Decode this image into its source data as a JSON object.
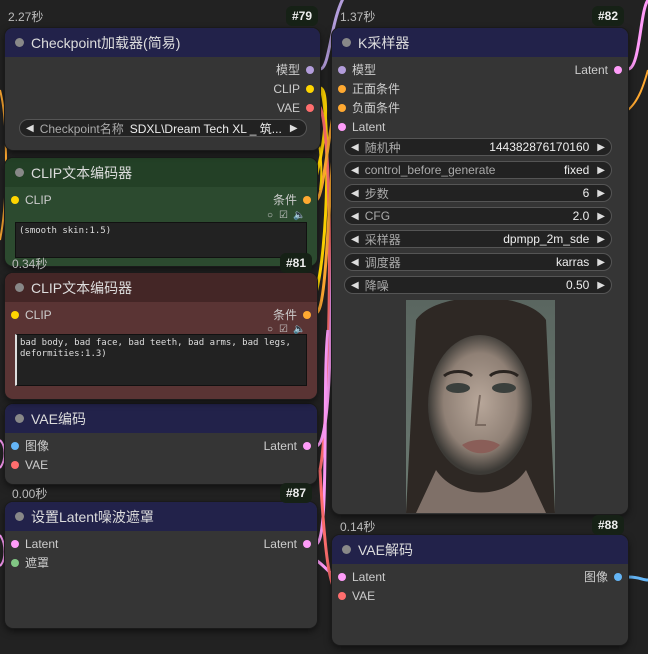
{
  "nodes": {
    "checkpoint": {
      "time": "2.27秒",
      "id": "#79",
      "title": "Checkpoint加载器(简易)",
      "outputs": [
        "模型",
        "CLIP",
        "VAE"
      ],
      "widget": {
        "label": "Checkpoint名称",
        "value": "SDXL\\Dream Tech XL _ 筑..."
      }
    },
    "ksampler": {
      "time": "1.37秒",
      "id": "#82",
      "title": "K采样器",
      "inputs": [
        "模型",
        "正面条件",
        "负面条件",
        "Latent"
      ],
      "output": "Latent",
      "widgets": [
        {
          "label": "随机种",
          "value": "144382876170160"
        },
        {
          "label": "control_before_generate",
          "value": "fixed"
        },
        {
          "label": "步数",
          "value": "6"
        },
        {
          "label": "CFG",
          "value": "2.0"
        },
        {
          "label": "采样器",
          "value": "dpmpp_2m_sde"
        },
        {
          "label": "调度器",
          "value": "karras"
        },
        {
          "label": "降噪",
          "value": "0.50"
        }
      ]
    },
    "clip_pos": {
      "title": "CLIP文本编码器",
      "input": "CLIP",
      "output": "条件",
      "text": "(smooth skin:1.5)"
    },
    "clip_neg": {
      "time": "0.34秒",
      "id": "#81",
      "title": "CLIP文本编码器",
      "input": "CLIP",
      "output": "条件",
      "text": "bad body, bad face, bad teeth, bad arms, bad legs,\ndeformities:1.3)"
    },
    "vae_encode": {
      "title": "VAE编码",
      "inputs": [
        "图像",
        "VAE"
      ],
      "output": "Latent"
    },
    "latent_mask": {
      "time": "0.00秒",
      "id": "#87",
      "title": "设置Latent噪波遮罩",
      "inputs": [
        "Latent",
        "遮罩"
      ],
      "output": "Latent"
    },
    "vae_decode": {
      "time": "0.14秒",
      "id": "#88",
      "title": "VAE解码",
      "inputs": [
        "Latent",
        "VAE"
      ],
      "output": "图像"
    }
  },
  "colors": {
    "model": "#b39ddb",
    "clip": "#ffd500",
    "vae": "#ff6e6e",
    "cond": "#ffa931",
    "latent": "#ff9cf9",
    "image": "#64b5f6",
    "mask": "#81c784"
  }
}
